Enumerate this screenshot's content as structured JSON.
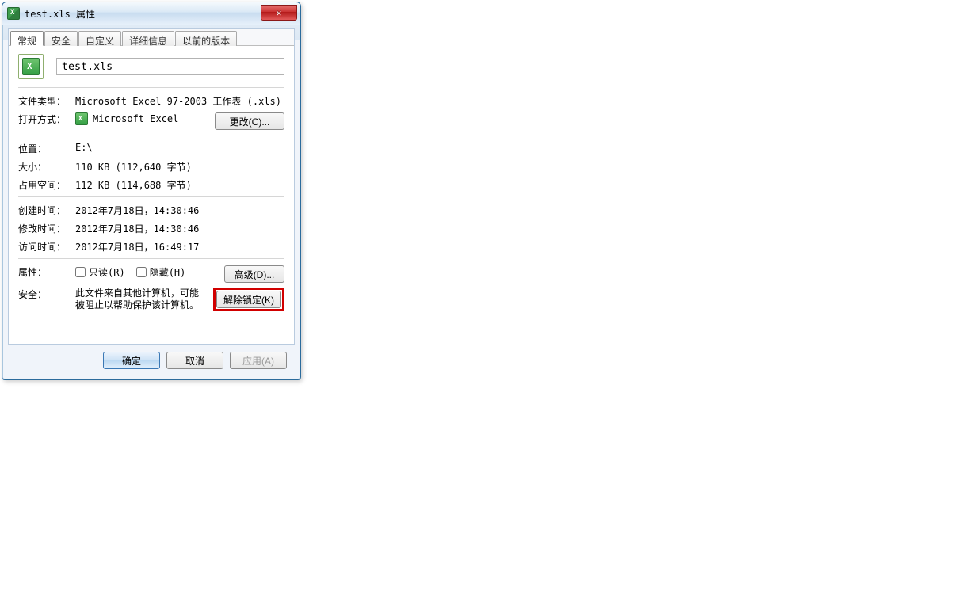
{
  "window": {
    "title": "test.xls 属性"
  },
  "tabs": {
    "general": "常规",
    "security": "安全",
    "custom": "自定义",
    "details": "详细信息",
    "previous": "以前的版本"
  },
  "file": {
    "name": "test.xls"
  },
  "labels": {
    "file_type": "文件类型：",
    "opens_with": "打开方式：",
    "location": "位置：",
    "size": "大小：",
    "size_on_disk": "占用空间：",
    "created": "创建时间：",
    "modified": "修改时间：",
    "accessed": "访问时间：",
    "attributes": "属性：",
    "security_label": "安全："
  },
  "values": {
    "file_type": "Microsoft Excel 97-2003 工作表 (.xls)",
    "opens_with_app": "Microsoft Excel",
    "location": "E:\\",
    "size": "110 KB (112,640 字节)",
    "size_on_disk": "112 KB (114,688 字节)",
    "created": "2012年7月18日，14:30:46",
    "modified": "2012年7月18日，14:30:46",
    "accessed": "2012年7月18日，16:49:17",
    "security_text": "此文件来自其他计算机，可能被阻止以帮助保护该计算机。"
  },
  "buttons": {
    "change": "更改(C)...",
    "advanced": "高级(D)...",
    "unblock": "解除锁定(K)",
    "ok": "确定",
    "cancel": "取消",
    "apply": "应用(A)"
  },
  "checkboxes": {
    "readonly": "只读(R)",
    "hidden": "隐藏(H)"
  }
}
